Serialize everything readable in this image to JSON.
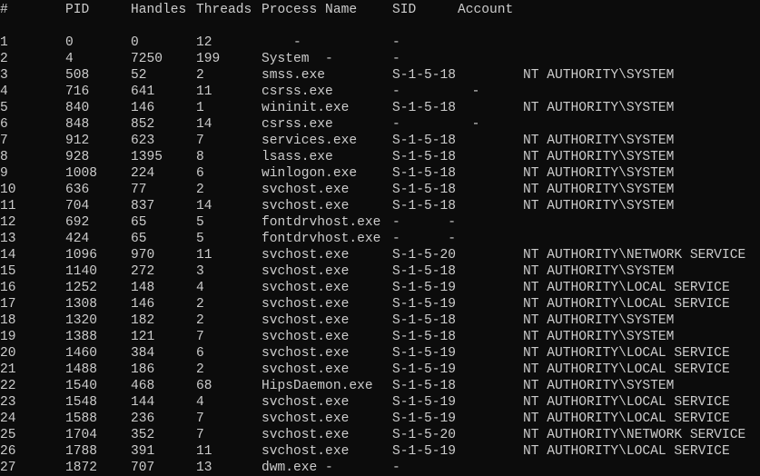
{
  "header": {
    "num": "#",
    "pid": "PID",
    "handles": "Handles",
    "threads": "Threads",
    "process_name": "Process Name",
    "sid": "SID",
    "account": "Account"
  },
  "rows": [
    {
      "num": "1",
      "pid": "0",
      "handles": "0",
      "threads": "12",
      "proc": "    -",
      "sid": "-",
      "acct": ""
    },
    {
      "num": "2",
      "pid": "4",
      "handles": "7250",
      "threads": "199",
      "proc": "System  -",
      "sid": "-",
      "acct": ""
    },
    {
      "num": "3",
      "pid": "508",
      "handles": "52",
      "threads": "2",
      "proc": "smss.exe",
      "sid": "S-1-5-18",
      "acct": "NT AUTHORITY\\SYSTEM"
    },
    {
      "num": "4",
      "pid": "716",
      "handles": "641",
      "threads": "11",
      "proc": "csrss.exe",
      "sid": "-         -",
      "acct": ""
    },
    {
      "num": "5",
      "pid": "840",
      "handles": "146",
      "threads": "1",
      "proc": "wininit.exe",
      "sid": "S-1-5-18",
      "acct": "NT AUTHORITY\\SYSTEM"
    },
    {
      "num": "6",
      "pid": "848",
      "handles": "852",
      "threads": "14",
      "proc": "csrss.exe",
      "sid": "-         -",
      "acct": ""
    },
    {
      "num": "7",
      "pid": "912",
      "handles": "623",
      "threads": "7",
      "proc": "services.exe",
      "sid": "S-1-5-18",
      "acct": "NT AUTHORITY\\SYSTEM"
    },
    {
      "num": "8",
      "pid": "928",
      "handles": "1395",
      "threads": "8",
      "proc": "lsass.exe",
      "sid": "S-1-5-18",
      "acct": "NT AUTHORITY\\SYSTEM"
    },
    {
      "num": "9",
      "pid": "1008",
      "handles": "224",
      "threads": "6",
      "proc": "winlogon.exe",
      "sid": "S-1-5-18",
      "acct": "NT AUTHORITY\\SYSTEM"
    },
    {
      "num": "10",
      "pid": "636",
      "handles": "77",
      "threads": "2",
      "proc": "svchost.exe",
      "sid": "S-1-5-18",
      "acct": "NT AUTHORITY\\SYSTEM"
    },
    {
      "num": "11",
      "pid": "704",
      "handles": "837",
      "threads": "14",
      "proc": "svchost.exe",
      "sid": "S-1-5-18",
      "acct": "NT AUTHORITY\\SYSTEM"
    },
    {
      "num": "12",
      "pid": "692",
      "handles": "65",
      "threads": "5",
      "proc": "fontdrvhost.exe",
      "sid": "-      -",
      "acct": ""
    },
    {
      "num": "13",
      "pid": "424",
      "handles": "65",
      "threads": "5",
      "proc": "fontdrvhost.exe",
      "sid": "-      -",
      "acct": ""
    },
    {
      "num": "14",
      "pid": "1096",
      "handles": "970",
      "threads": "11",
      "proc": "svchost.exe",
      "sid": "S-1-5-20",
      "acct": "NT AUTHORITY\\NETWORK SERVICE"
    },
    {
      "num": "15",
      "pid": "1140",
      "handles": "272",
      "threads": "3",
      "proc": "svchost.exe",
      "sid": "S-1-5-18",
      "acct": "NT AUTHORITY\\SYSTEM"
    },
    {
      "num": "16",
      "pid": "1252",
      "handles": "148",
      "threads": "4",
      "proc": "svchost.exe",
      "sid": "S-1-5-19",
      "acct": "NT AUTHORITY\\LOCAL SERVICE"
    },
    {
      "num": "17",
      "pid": "1308",
      "handles": "146",
      "threads": "2",
      "proc": "svchost.exe",
      "sid": "S-1-5-19",
      "acct": "NT AUTHORITY\\LOCAL SERVICE"
    },
    {
      "num": "18",
      "pid": "1320",
      "handles": "182",
      "threads": "2",
      "proc": "svchost.exe",
      "sid": "S-1-5-18",
      "acct": "NT AUTHORITY\\SYSTEM"
    },
    {
      "num": "19",
      "pid": "1388",
      "handles": "121",
      "threads": "7",
      "proc": "svchost.exe",
      "sid": "S-1-5-18",
      "acct": "NT AUTHORITY\\SYSTEM"
    },
    {
      "num": "20",
      "pid": "1460",
      "handles": "384",
      "threads": "6",
      "proc": "svchost.exe",
      "sid": "S-1-5-19",
      "acct": "NT AUTHORITY\\LOCAL SERVICE"
    },
    {
      "num": "21",
      "pid": "1488",
      "handles": "186",
      "threads": "2",
      "proc": "svchost.exe",
      "sid": "S-1-5-19",
      "acct": "NT AUTHORITY\\LOCAL SERVICE"
    },
    {
      "num": "22",
      "pid": "1540",
      "handles": "468",
      "threads": "68",
      "proc": "HipsDaemon.exe",
      "sid": "S-1-5-18",
      "acct": "NT AUTHORITY\\SYSTEM"
    },
    {
      "num": "23",
      "pid": "1548",
      "handles": "144",
      "threads": "4",
      "proc": "svchost.exe",
      "sid": "S-1-5-19",
      "acct": "NT AUTHORITY\\LOCAL SERVICE"
    },
    {
      "num": "24",
      "pid": "1588",
      "handles": "236",
      "threads": "7",
      "proc": "svchost.exe",
      "sid": "S-1-5-19",
      "acct": "NT AUTHORITY\\LOCAL SERVICE"
    },
    {
      "num": "25",
      "pid": "1704",
      "handles": "352",
      "threads": "7",
      "proc": "svchost.exe",
      "sid": "S-1-5-20",
      "acct": "NT AUTHORITY\\NETWORK SERVICE"
    },
    {
      "num": "26",
      "pid": "1788",
      "handles": "391",
      "threads": "11",
      "proc": "svchost.exe",
      "sid": "S-1-5-19",
      "acct": "NT AUTHORITY\\LOCAL SERVICE"
    },
    {
      "num": "27",
      "pid": "1872",
      "handles": "707",
      "threads": "13",
      "proc": "dwm.exe -",
      "sid": "-",
      "acct": ""
    }
  ]
}
